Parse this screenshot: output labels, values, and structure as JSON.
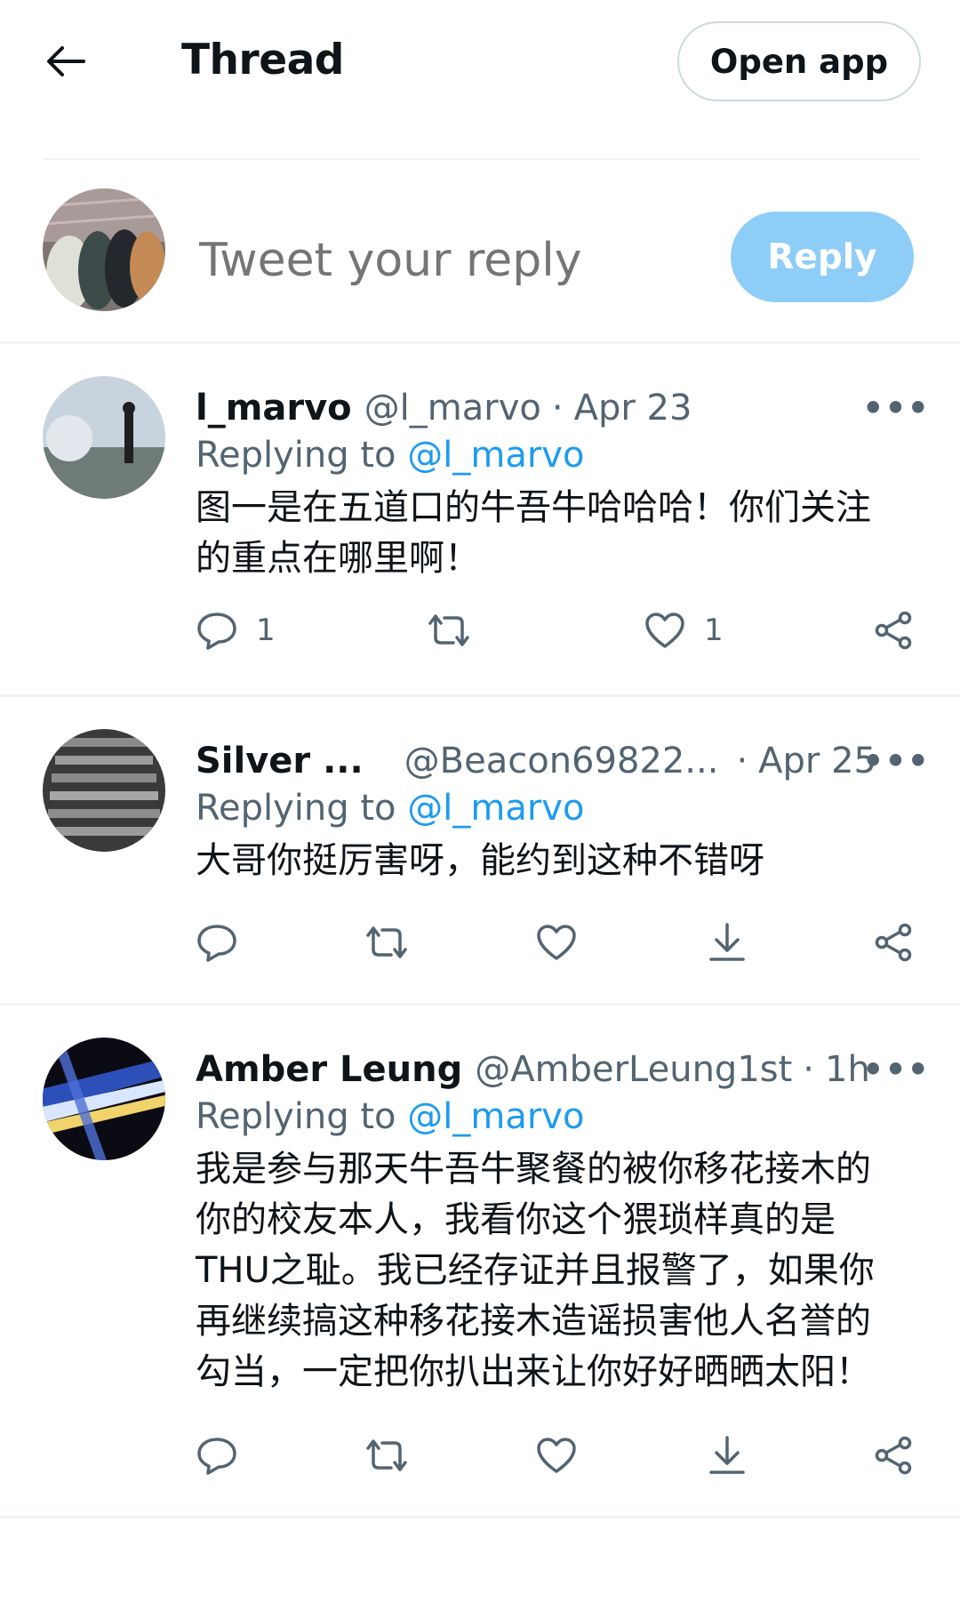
{
  "header": {
    "back_icon": "arrow-left-icon",
    "title": "Thread",
    "open_app_label": "Open app"
  },
  "composer": {
    "placeholder": "Tweet your reply",
    "reply_label": "Reply",
    "reply_color": "#8ecdf8"
  },
  "tweets": [
    {
      "name": "l_marvo",
      "handle": "@l_marvo",
      "sep": "·",
      "time": "Apr 23",
      "replying_prefix": "Replying to",
      "replying_to": "@l_marvo",
      "text": "图一是在五道口的牛吾牛哈哈哈！你们关注\n的重点在哪里啊！",
      "reply_count": "1",
      "retweet_count": "",
      "like_count": "1"
    },
    {
      "name": "Silver ...",
      "handle": "@Beacon69822...",
      "sep": "·",
      "time": "Apr 25",
      "replying_prefix": "Replying to",
      "replying_to": "@l_marvo",
      "text": "大哥你挺厉害呀，能约到这种不错呀",
      "reply_count": "",
      "retweet_count": "",
      "like_count": ""
    },
    {
      "name": "Amber Leung",
      "handle": "@AmberLeung1st",
      "sep": "·",
      "time": "1h",
      "replying_prefix": "Replying to",
      "replying_to": "@l_marvo",
      "text": "我是参与那天牛吾牛聚餐的被你移花接木的\n你的校友本人，我看你这个猥琐样真的是\nTHU之耻。我已经存证并且报警了，如果你\n再继续搞这种移花接木造谣损害他人名誉的\n勾当，一定把你扒出来让你好好晒晒太阳！",
      "reply_count": "",
      "retweet_count": "",
      "like_count": ""
    }
  ],
  "colors": {
    "link": "#1d9bf0",
    "secondary_text": "#536471",
    "divider": "#eff3f4"
  }
}
